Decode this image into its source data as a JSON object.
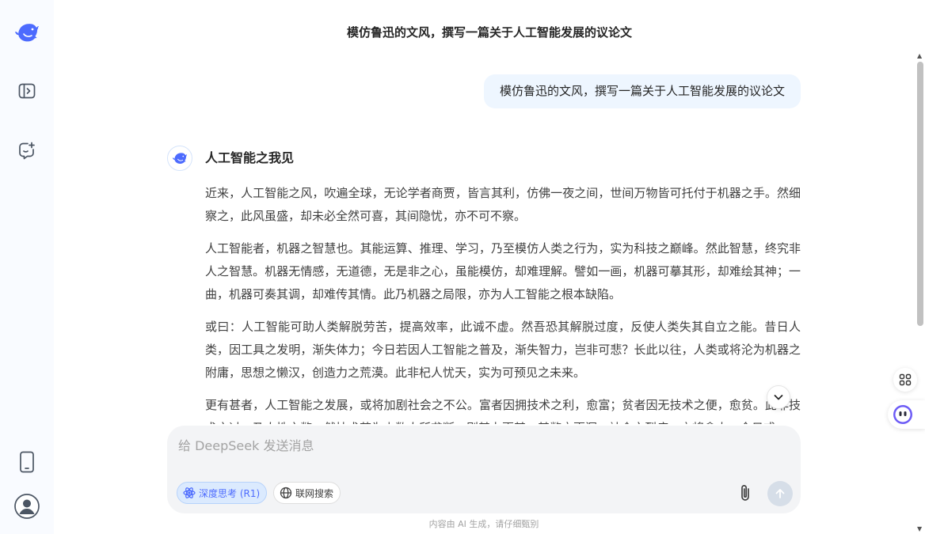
{
  "conversation": {
    "title": "模仿鲁迅的文风，撰写一篇关于人工智能发展的议论文"
  },
  "user_message": "模仿鲁迅的文风，撰写一篇关于人工智能发展的议论文",
  "answer": {
    "heading": "人工智能之我见",
    "paragraphs": [
      "近来，人工智能之风，吹遍全球，无论学者商贾，皆言其利，仿佛一夜之间，世间万物皆可托付于机器之手。然细察之，此风虽盛，却未必全然可喜，其间隐忧，亦不可不察。",
      "人工智能者，机器之智慧也。其能运算、推理、学习，乃至模仿人类之行为，实为科技之巅峰。然此智慧，终究非人之智慧。机器无情感，无道德，无是非之心，虽能模仿，却难理解。譬如一画，机器可摹其形，却难绘其神；一曲，机器可奏其调，却难传其情。此乃机器之局限，亦为人工智能之根本缺陷。",
      "或曰：人工智能可助人类解脱劳苦，提高效率，此诚不虚。然吾恐其解脱过度，反使人类失其自立之能。昔日人类，因工具之发明，渐失体力；今日若因人工智能之普及，渐失智力，岂非可悲？长此以往，人类或将沦为机器之附庸，思想之懒汉，创造力之荒漠。此非杞人忧天，实为可预见之未来。",
      "更有甚者，人工智能之发展，或将加剧社会之不公。富者因拥技术之利，愈富；贫者因无技术之便，愈贫。此非技术之过，乃人性之弊。然技术若为少数人所垄断，则其力更甚，其弊亦更深，社会之裂痕，亦将愈大，今日或"
    ]
  },
  "composer": {
    "placeholder": "给 DeepSeek 发送消息",
    "deep_think_label": "深度思考 (R1)",
    "web_search_label": "联网搜索"
  },
  "disclaimer": "内容由 AI 生成，请仔细甄别",
  "icons": {
    "logo": "deepseek-whale-icon",
    "collapse": "sidebar-toggle-icon",
    "new_chat": "new-chat-icon",
    "mobile": "mobile-phone-icon",
    "avatar": "user-avatar-icon",
    "scroll_down": "chevron-down-icon",
    "attach": "paperclip-icon",
    "send": "arrow-up-icon",
    "deep_think": "atom-icon",
    "web_search": "globe-icon"
  },
  "colors": {
    "brand": "#4d6bfe",
    "user_bubble": "#eef6ff",
    "sidebar_bg": "#f9fbff",
    "composer_bg": "#f3f4f6"
  }
}
